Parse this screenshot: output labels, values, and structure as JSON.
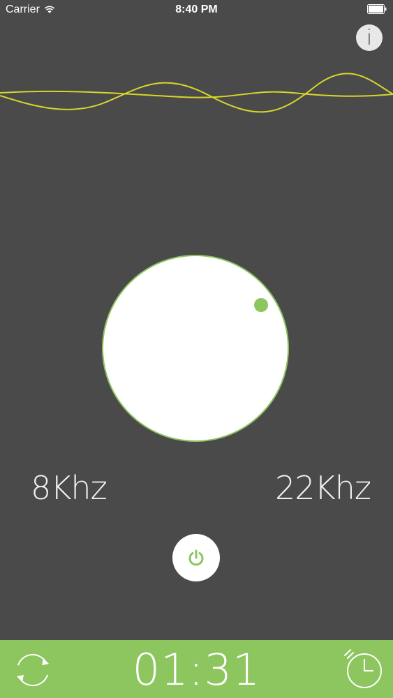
{
  "status_bar": {
    "carrier": "Carrier",
    "time": "8:40 PM"
  },
  "info_button": {
    "label": "i"
  },
  "dial": {
    "min_label": "8Khz",
    "max_label": "22Khz"
  },
  "bottom_bar": {
    "timer": "01:31"
  },
  "colors": {
    "background": "#4a4a4b",
    "accent_green": "#8dc55f",
    "wave_yellow": "#d8d62a"
  },
  "icons": {
    "info": "info-icon",
    "power": "power-icon",
    "repeat": "repeat-icon",
    "clock": "clock-icon",
    "wifi": "wifi-icon",
    "battery": "battery-icon"
  }
}
